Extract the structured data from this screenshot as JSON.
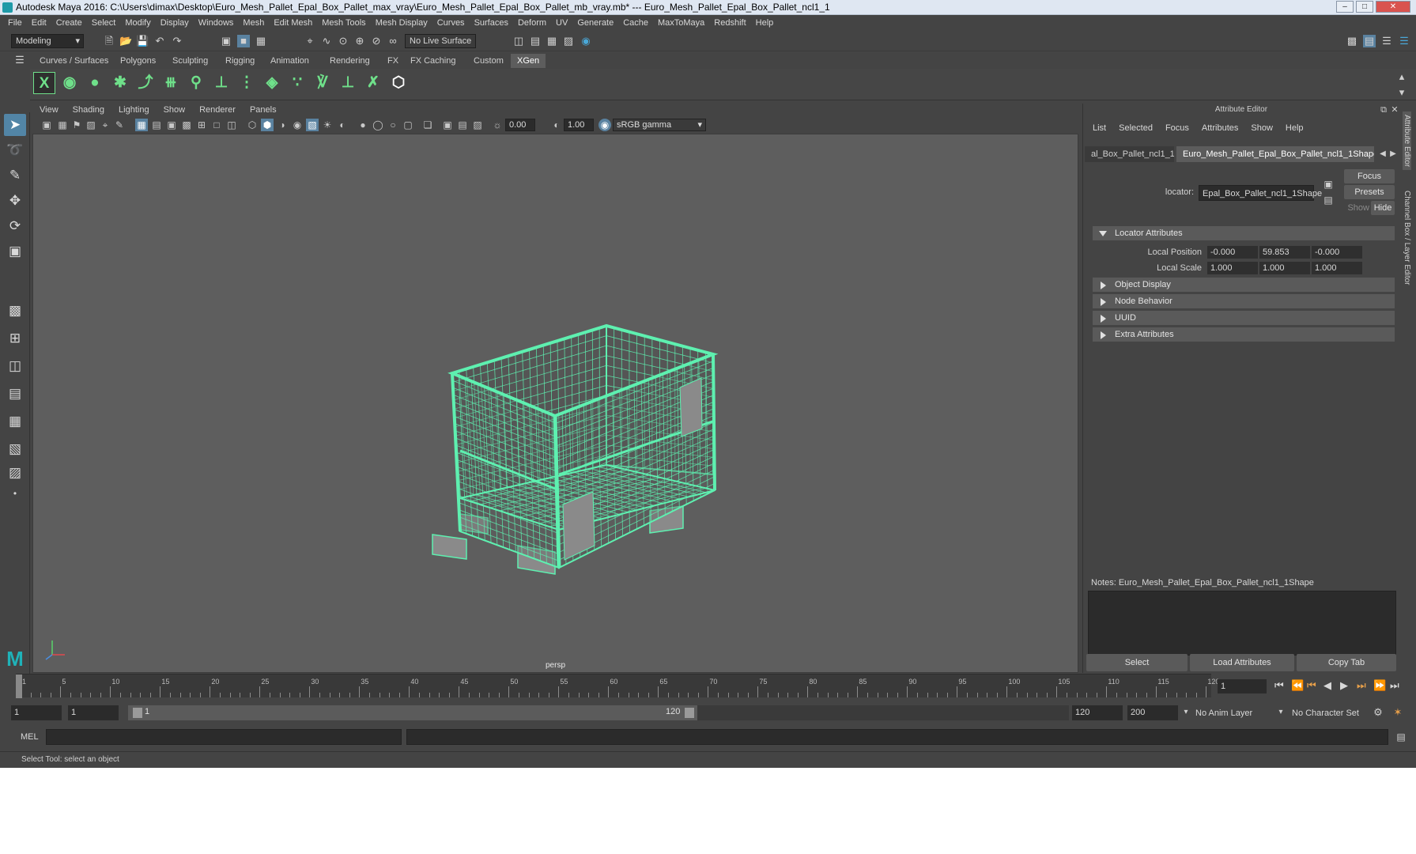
{
  "window": {
    "title": "Autodesk Maya 2016: C:\\Users\\dimax\\Desktop\\Euro_Mesh_Pallet_Epal_Box_Pallet_max_vray\\Euro_Mesh_Pallet_Epal_Box_Pallet_mb_vray.mb*   ---   Euro_Mesh_Pallet_Epal_Box_Pallet_ncl1_1"
  },
  "menubar": [
    "File",
    "Edit",
    "Create",
    "Select",
    "Modify",
    "Display",
    "Windows",
    "Mesh",
    "Edit Mesh",
    "Mesh Tools",
    "Mesh Display",
    "Curves",
    "Surfaces",
    "Deform",
    "UV",
    "Generate",
    "Cache",
    "MaxToMaya",
    "Redshift",
    "Help"
  ],
  "statusline": {
    "mode": "Modeling",
    "live_surface": "No Live Surface"
  },
  "shelf_tabs": [
    "Curves / Surfaces",
    "Polygons",
    "Sculpting",
    "Rigging",
    "Animation",
    "Rendering",
    "FX",
    "FX Caching",
    "Custom",
    "XGen"
  ],
  "active_shelf_tab": "XGen",
  "viewport": {
    "menu": [
      "View",
      "Shading",
      "Lighting",
      "Show",
      "Renderer",
      "Panels"
    ],
    "exposure": "0.00",
    "gamma": "1.00",
    "color_space": "sRGB gamma",
    "camera_label": "persp",
    "wire_color": "#5ef0b0",
    "background": "#5e5e5e"
  },
  "attribute_editor": {
    "title": "Attribute Editor",
    "menu": [
      "List",
      "Selected",
      "Focus",
      "Attributes",
      "Show",
      "Help"
    ],
    "tabs": [
      "al_Box_Pallet_ncl1_1",
      "Euro_Mesh_Pallet_Epal_Box_Pallet_ncl1_1Shape"
    ],
    "node_label": "locator:",
    "node_name": "Epal_Box_Pallet_ncl1_1Shape",
    "focus_btn": "Focus",
    "presets_btn": "Presets",
    "show_label": "Show",
    "hide_btn": "Hide",
    "sections": {
      "locator": "Locator Attributes",
      "object_display": "Object Display",
      "node_behavior": "Node Behavior",
      "uuid": "UUID",
      "extra": "Extra Attributes"
    },
    "local_position": {
      "label": "Local Position",
      "x": "-0.000",
      "y": "59.853",
      "z": "-0.000"
    },
    "local_scale": {
      "label": "Local Scale",
      "x": "1.000",
      "y": "1.000",
      "z": "1.000"
    },
    "notes_label": "Notes:  Euro_Mesh_Pallet_Epal_Box_Pallet_ncl1_1Shape",
    "bottom_buttons": [
      "Select",
      "Load Attributes",
      "Copy Tab"
    ]
  },
  "side_tabs": [
    "Attribute Editor",
    "Channel Box / Layer Editor"
  ],
  "timeline": {
    "ticks": [
      "1",
      "5",
      "10",
      "15",
      "20",
      "25",
      "30",
      "35",
      "40",
      "45",
      "50",
      "55",
      "60",
      "65",
      "70",
      "75",
      "80",
      "85",
      "90",
      "95",
      "100",
      "105",
      "110",
      "115",
      "120"
    ],
    "current_frame": "1"
  },
  "range": {
    "start": "1",
    "playback_start": "1",
    "slider_start": "1",
    "slider_end": "120",
    "playback_end": "120",
    "end": "200",
    "anim_layer": "No Anim Layer",
    "character_set": "No Character Set"
  },
  "command_line": {
    "label": "MEL"
  },
  "help_line": "Select Tool: select an object"
}
